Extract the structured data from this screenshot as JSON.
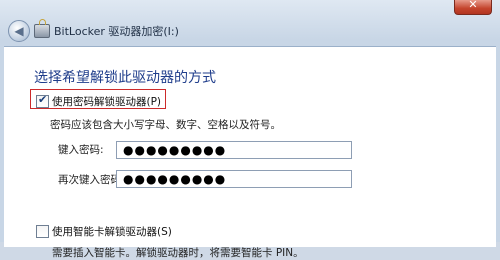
{
  "window": {
    "title": "BitLocker 驱动器加密(I:)",
    "close_label": "✕"
  },
  "main": {
    "heading": "选择希望解锁此驱动器的方式",
    "password_option": {
      "label": "使用密码解锁驱动器(P)",
      "checked": true,
      "description": "密码应该包含大小写字母、数字、空格以及符号。",
      "enter_label": "键入密码:",
      "enter_value": "●●●●●●●●●",
      "reenter_label": "再次键入密码:",
      "reenter_value": "●●●●●●●●●"
    },
    "smartcard_option": {
      "label": "使用智能卡解锁驱动器(S)",
      "checked": false,
      "description": "需要插入智能卡。解锁驱动器时，将需要智能卡 PIN。"
    }
  }
}
